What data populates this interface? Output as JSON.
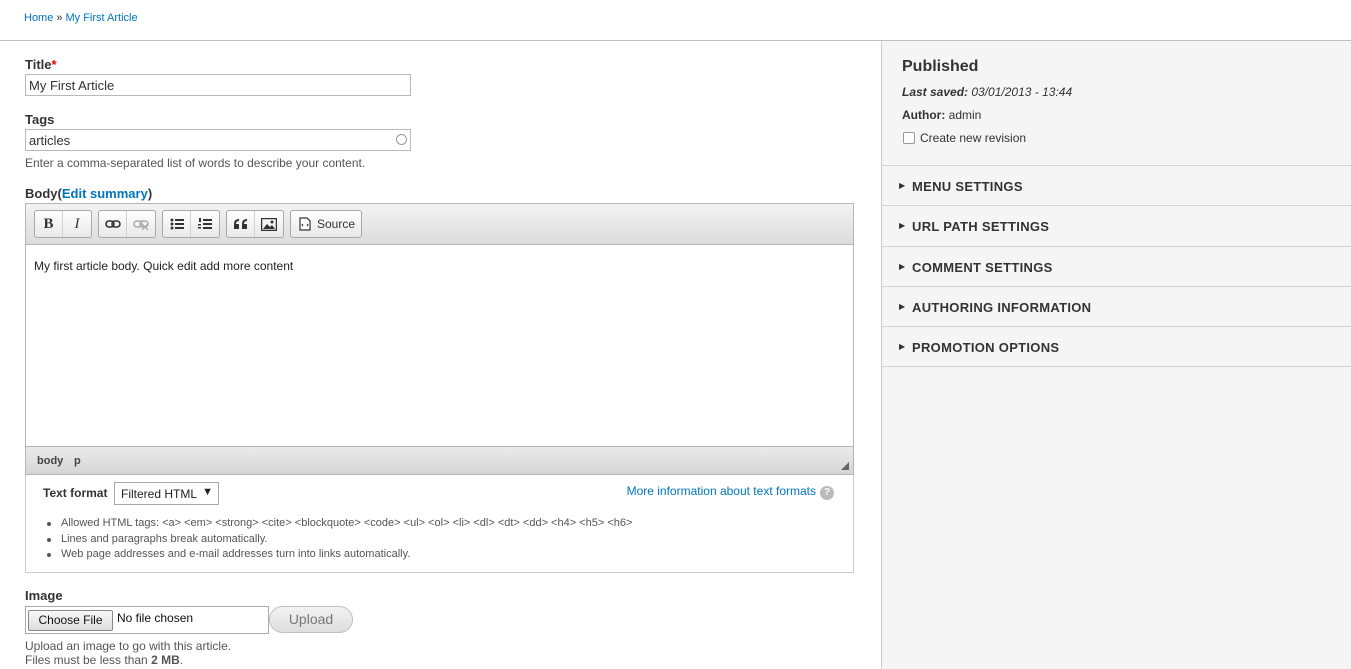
{
  "breadcrumb": {
    "home": "Home",
    "separator": "»",
    "current": "My First Article"
  },
  "form": {
    "title_label": "Title",
    "required_mark": "*",
    "title_value": "My First Article",
    "tags_label": "Tags",
    "tags_value": "articles",
    "tags_description": "Enter a comma-separated list of words to describe your content.",
    "body_label": "Body",
    "body_paren_open": "(",
    "edit_summary_link": "Edit summary",
    "body_paren_close": ")"
  },
  "editor": {
    "toolbar": {
      "bold": "B",
      "italic": "I",
      "link_icon": "link-icon",
      "unlink_icon": "unlink-icon",
      "bullet_list_icon": "bulleted-list-icon",
      "numbered_list_icon": "numbered-list-icon",
      "blockquote_icon": "blockquote-icon",
      "image_icon": "image-icon",
      "source_label": "Source"
    },
    "content": "My first article body. Quick edit add more content",
    "path": [
      "body",
      "p"
    ]
  },
  "text_format": {
    "label": "Text format",
    "selected": "Filtered HTML",
    "more_info_link": "More information about text formats",
    "help_glyph": "?",
    "tips": [
      "Allowed HTML tags: <a> <em> <strong> <cite> <blockquote> <code> <ul> <ol> <li> <dl> <dt> <dd> <h4> <h5> <h6>",
      "Lines and paragraphs break automatically.",
      "Web page addresses and e-mail addresses turn into links automatically."
    ]
  },
  "image": {
    "label": "Image",
    "choose_file": "Choose File",
    "no_file": "No file chosen",
    "upload": "Upload",
    "description": "Upload an image to go with this article.",
    "size_prefix": "Files must be less than ",
    "size_value": "2 MB",
    "size_suffix": "."
  },
  "sidebar": {
    "status": "Published",
    "last_saved_label": "Last saved:",
    "last_saved_value": "03/01/2013 - 13:44",
    "author_label": "Author:",
    "author_value": "admin",
    "create_revision": "Create new revision",
    "create_revision_checked": false,
    "sections": [
      {
        "label": "MENU SETTINGS"
      },
      {
        "label": "URL PATH SETTINGS"
      },
      {
        "label": "COMMENT SETTINGS"
      },
      {
        "label": "AUTHORING INFORMATION"
      },
      {
        "label": "PROMOTION OPTIONS"
      }
    ]
  },
  "colors": {
    "link": "#0074bd",
    "required": "#ee0000",
    "sidebar_bg": "#f5f5f5"
  }
}
